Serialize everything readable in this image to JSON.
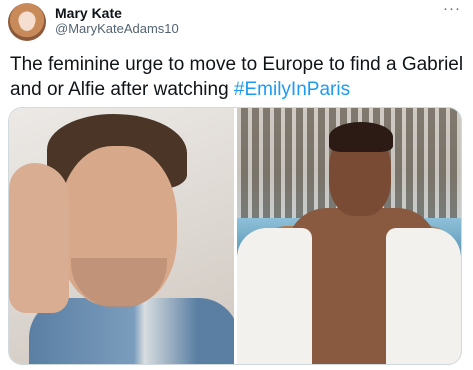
{
  "author": {
    "display_name": "Mary Kate",
    "handle": "@MaryKateAdams10"
  },
  "more_glyph": "···",
  "tweet": {
    "text": "The feminine urge to move to Europe to find a Gabriel and or Alfie after watching ",
    "hashtag": "#EmilyInParis"
  },
  "media": [
    {
      "name": "left-photo"
    },
    {
      "name": "right-photo"
    }
  ],
  "colors": {
    "link": "#1d9bf0",
    "secondary_text": "#536471",
    "border": "#cfd9de"
  }
}
